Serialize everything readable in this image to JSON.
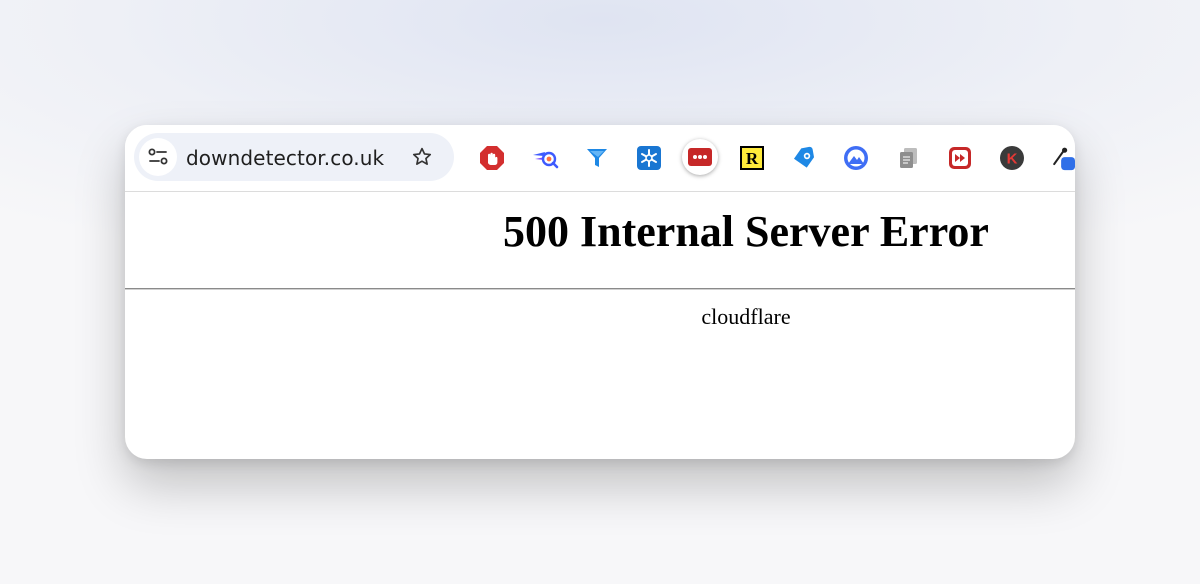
{
  "browser": {
    "url": "downdetector.co.uk",
    "extensions": [
      {
        "name": "stop-hand-icon"
      },
      {
        "name": "detective-glass-icon"
      },
      {
        "name": "funnel-icon"
      },
      {
        "name": "snowflake-icon"
      },
      {
        "name": "dots-icon"
      },
      {
        "name": "r-badge-icon",
        "text": "R"
      },
      {
        "name": "tag-icon"
      },
      {
        "name": "mountain-circle-icon"
      },
      {
        "name": "copy-pages-icon"
      },
      {
        "name": "fast-forward-icon"
      },
      {
        "name": "k-avatar-icon",
        "text": "K"
      },
      {
        "name": "eyedropper-icon"
      }
    ]
  },
  "page": {
    "heading": "500 Internal Server Error",
    "server": "cloudflare"
  }
}
